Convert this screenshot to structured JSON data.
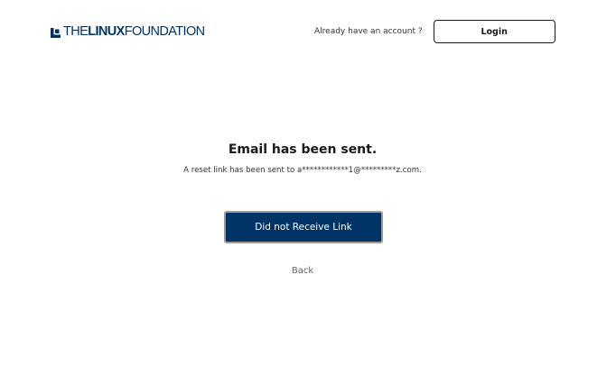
{
  "header": {
    "logo": {
      "word_the": "THE",
      "word_linux": "LINUX",
      "word_foundation": "FOUNDATION",
      "color": "#003366"
    },
    "account_prompt": "Already have an account ?",
    "login_label": "Login"
  },
  "main": {
    "title": "Email has been sent.",
    "message": "A reset link has been sent to a************1@*********z.com.",
    "resend_label": "Did not Receive Link",
    "back_label": "Back"
  },
  "colors": {
    "brand_navy": "#003366",
    "text_dark": "#1a1a1a",
    "text_muted": "#666666"
  },
  "icons": {
    "logo_mark": "linux-foundation-logo-icon"
  }
}
